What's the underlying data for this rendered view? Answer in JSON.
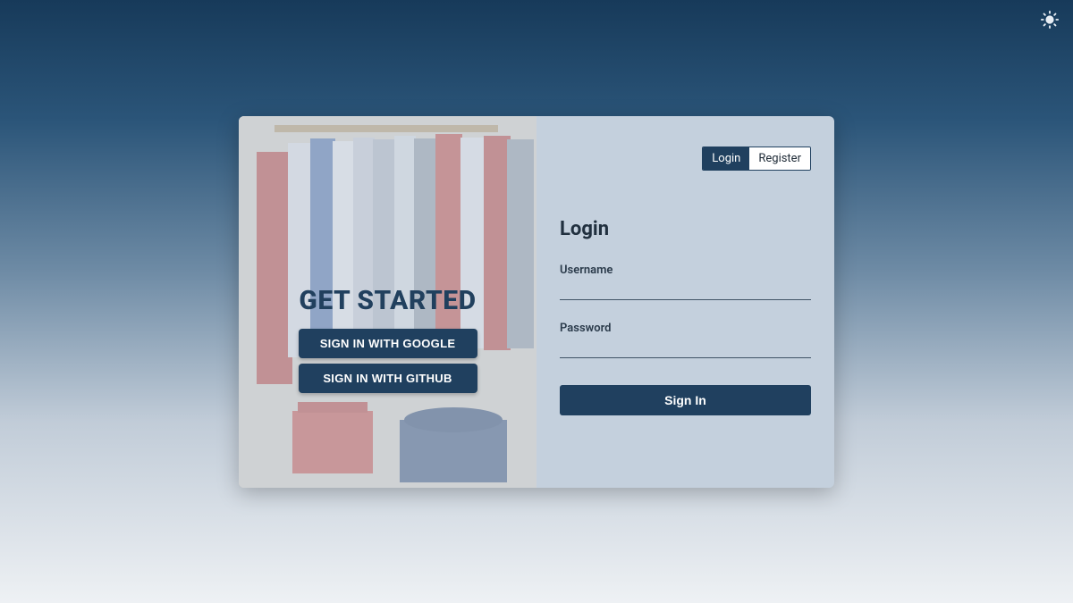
{
  "theme_icon": "sun-icon",
  "left": {
    "heading": "GET STARTED",
    "google_button": "SIGN IN WITH GOOGLE",
    "github_button": "SIGN IN WITH GITHUB"
  },
  "tabs": {
    "login": "Login",
    "register": "Register"
  },
  "form": {
    "title": "Login",
    "username_label": "Username",
    "username_value": "",
    "password_label": "Password",
    "password_value": "",
    "submit_label": "Sign In"
  },
  "colors": {
    "primary": "#20405f",
    "panel": "#c4d0dd"
  }
}
